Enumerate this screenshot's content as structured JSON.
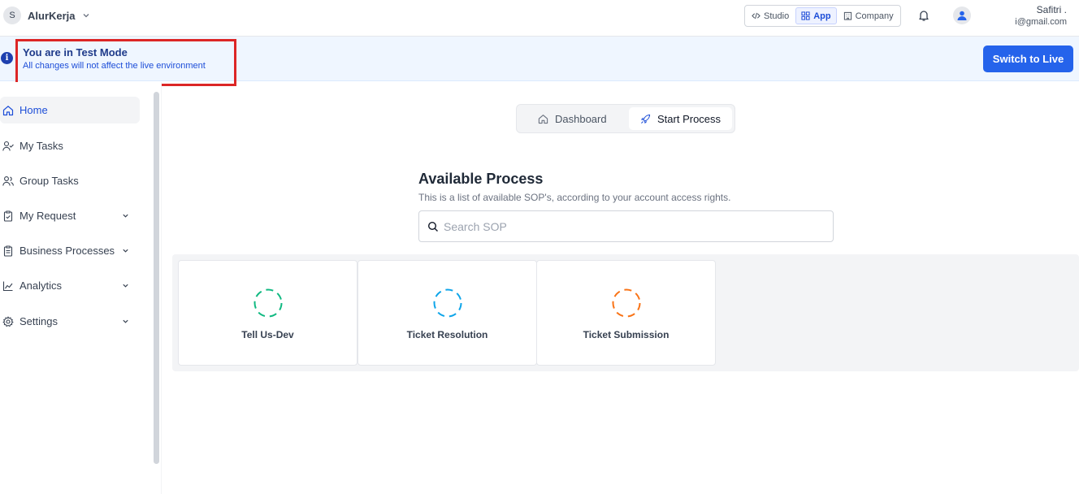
{
  "org": {
    "initial": "S",
    "name": "AlurKerja"
  },
  "app_switcher": {
    "studio": "Studio",
    "app": "App",
    "company": "Company"
  },
  "user": {
    "name": "Safitri .",
    "email": "i@gmail.com"
  },
  "banner": {
    "title": "You are in Test Mode",
    "subtitle": "All changes will not affect the live environment",
    "button": "Switch to Live"
  },
  "sidebar": {
    "items": [
      {
        "label": "Home",
        "icon": "home-icon",
        "active": true
      },
      {
        "label": "My Tasks",
        "icon": "user-check-icon"
      },
      {
        "label": "Group Tasks",
        "icon": "users-icon"
      },
      {
        "label": "My Request",
        "icon": "clipboard-check-icon",
        "expandable": true
      },
      {
        "label": "Business Processes",
        "icon": "clipboard-list-icon",
        "expandable": true
      },
      {
        "label": "Analytics",
        "icon": "chart-line-icon",
        "expandable": true
      },
      {
        "label": "Settings",
        "icon": "gear-icon",
        "expandable": true
      }
    ]
  },
  "tabs": {
    "dashboard": "Dashboard",
    "start_process": "Start Process"
  },
  "main": {
    "title": "Available Process",
    "subtitle": "This is a list of available SOP's, according to your account access rights.",
    "search_placeholder": "Search SOP"
  },
  "processes": [
    {
      "name": "Tell Us-Dev",
      "color": "#10b981"
    },
    {
      "name": "Ticket Resolution",
      "color": "#0ea5e9"
    },
    {
      "name": "Ticket Submission",
      "color": "#f97316"
    }
  ],
  "colors": {
    "primary": "#2563eb",
    "highlight_box": "#dc2626"
  }
}
